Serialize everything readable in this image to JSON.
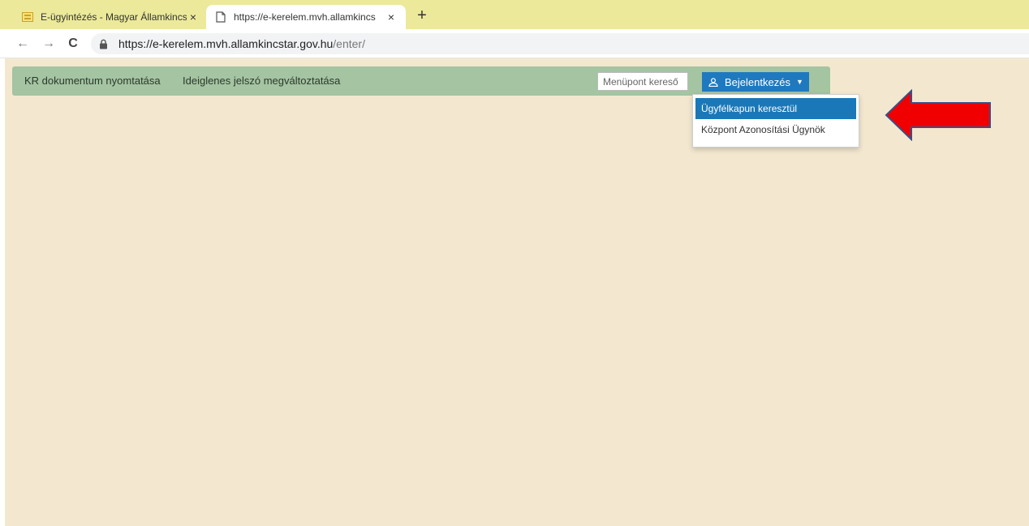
{
  "browser": {
    "tabs": [
      {
        "title": "E-ügyintézés - Magyar Államkincs",
        "close": "×"
      },
      {
        "title": "https://e-kerelem.mvh.allamkincs",
        "close": "×"
      }
    ],
    "new_tab": "+",
    "nav": {
      "back": "←",
      "forward": "→",
      "reload": "C"
    },
    "url_host": "https://e-kerelem.mvh.allamkincstar.gov.hu",
    "url_path": "/enter/"
  },
  "navbar": {
    "links": [
      "KR dokumentum nyomtatása",
      "Ideiglenes jelszó megváltoztatása"
    ],
    "search_placeholder": "Menüpont kereső",
    "login_label": "Bejelentkezés",
    "login_caret": "▼"
  },
  "dropdown": {
    "items": [
      "Ügyfélkapun keresztül",
      "Központ Azonosítási Ügynök"
    ]
  },
  "colors": {
    "tabstrip": "#ece99a",
    "page_bg": "#f3e8cf",
    "navbar": "#a4c4a2",
    "login_button": "#1f79bf",
    "highlight": "#1a78b8",
    "arrow": "#f00000"
  }
}
